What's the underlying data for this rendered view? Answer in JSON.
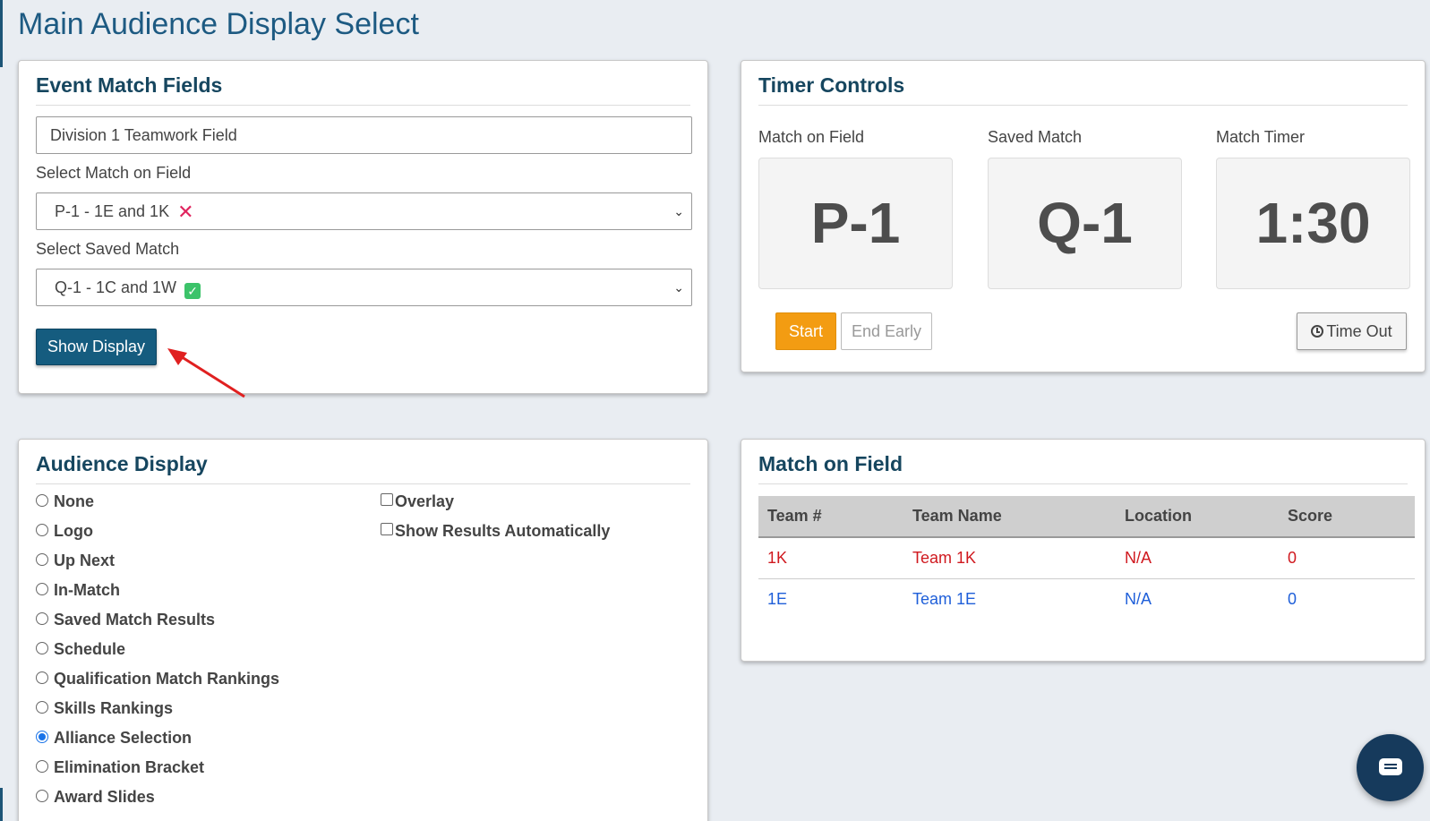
{
  "page": {
    "title": "Main Audience Display Select"
  },
  "event_match_fields": {
    "title": "Event Match Fields",
    "field_value": "Division 1 Teamwork Field",
    "select_match_label": "Select Match on Field",
    "select_match_value": "P-1 - 1E and 1K",
    "select_match_status_icon": "x-mark-icon",
    "select_saved_label": "Select Saved Match",
    "select_saved_value": "Q-1 - 1C and 1W",
    "select_saved_status_icon": "check-mark-icon",
    "show_display_label": "Show Display"
  },
  "timer_controls": {
    "title": "Timer Controls",
    "match_on_field_label": "Match on Field",
    "match_on_field_value": "P-1",
    "saved_match_label": "Saved Match",
    "saved_match_value": "Q-1",
    "match_timer_label": "Match Timer",
    "match_timer_value": "1:30",
    "start_label": "Start",
    "end_early_label": "End Early",
    "time_out_label": "Time Out"
  },
  "audience_display": {
    "title": "Audience Display",
    "options": [
      {
        "label": "None",
        "checked": false
      },
      {
        "label": "Logo",
        "checked": false
      },
      {
        "label": "Up Next",
        "checked": false
      },
      {
        "label": "In-Match",
        "checked": false
      },
      {
        "label": "Saved Match Results",
        "checked": false
      },
      {
        "label": "Schedule",
        "checked": false
      },
      {
        "label": "Qualification Match Rankings",
        "checked": false
      },
      {
        "label": "Skills Rankings",
        "checked": false
      },
      {
        "label": "Alliance Selection",
        "checked": true
      },
      {
        "label": "Elimination Bracket",
        "checked": false
      },
      {
        "label": "Award Slides",
        "checked": false
      }
    ],
    "checkboxes": [
      {
        "label": "Overlay",
        "checked": false
      },
      {
        "label": "Show Results Automatically",
        "checked": false
      }
    ]
  },
  "match_on_field": {
    "title": "Match on Field",
    "headers": [
      "Team #",
      "Team Name",
      "Location",
      "Score"
    ],
    "rows": [
      {
        "team": "1K",
        "name": "Team 1K",
        "location": "N/A",
        "score": "0",
        "alliance": "red"
      },
      {
        "team": "1E",
        "name": "Team 1E",
        "location": "N/A",
        "score": "0",
        "alliance": "blue"
      }
    ]
  },
  "colors": {
    "accent": "#155c7f",
    "start": "#f39c12",
    "red_alliance": "#d0191f",
    "blue_alliance": "#1f5fd9"
  }
}
